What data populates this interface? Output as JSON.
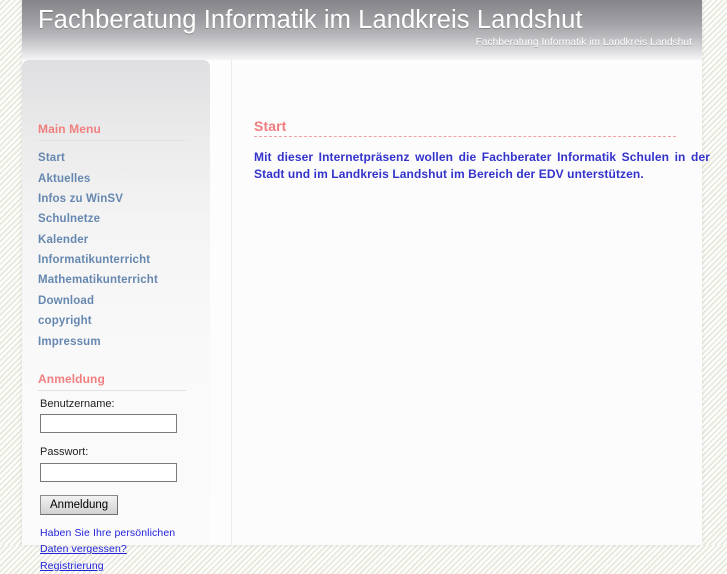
{
  "header": {
    "title": "Fachberatung Informatik im Landkreis Landshut",
    "subtitle": "Fachberatung Informatik im Landkreis Landshut"
  },
  "sidebar": {
    "main_menu": {
      "title": "Main Menu",
      "items": [
        {
          "label": "Start"
        },
        {
          "label": "Aktuelles"
        },
        {
          "label": "Infos zu WinSV"
        },
        {
          "label": "Schulnetze"
        },
        {
          "label": "Kalender"
        },
        {
          "label": "Informatikunterricht"
        },
        {
          "label": "Mathematikunterricht"
        },
        {
          "label": "Download"
        },
        {
          "label": "copyright"
        },
        {
          "label": "Impressum"
        }
      ]
    },
    "login": {
      "title": "Anmeldung",
      "username_label": "Benutzername:",
      "username_value": "",
      "password_label": "Passwort:",
      "password_value": "",
      "submit_label": "Anmeldung",
      "forgot_prefix": "Haben Sie Ihre persönlichen ",
      "forgot_link": "Daten vergessen?",
      "register_link": "Registrierung"
    }
  },
  "content": {
    "title": "Start",
    "text": "Mit dieser Internetpräsenz wollen die Fachberater Informatik Schulen in der Stadt und im Landkreis Landshut im Bereich der EDV unterstützen."
  },
  "colors": {
    "accent_red": "#f08080",
    "link_blue": "#6688b0",
    "content_blue": "#3333cc",
    "form_link_blue": "#2222dd"
  }
}
